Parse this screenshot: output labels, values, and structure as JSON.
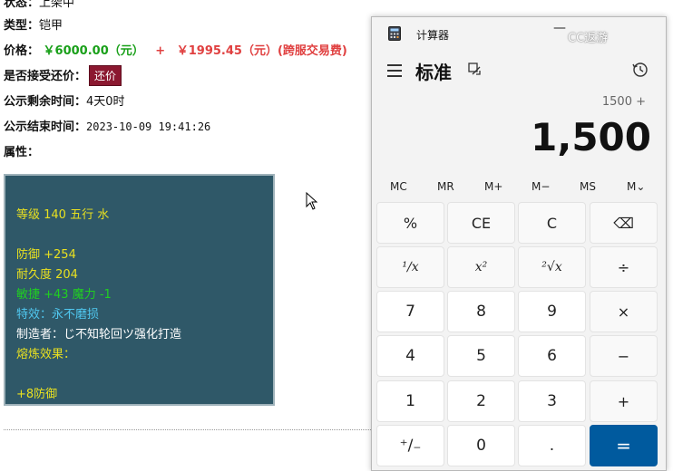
{
  "listing": {
    "status_label": "状态：",
    "status_value": "上架中",
    "type_label": "类型：",
    "type_value": "铠甲",
    "price_label": "价格：",
    "price_main": "￥6000.00（元）",
    "price_plus": "+",
    "price_fee": "￥1995.45（元）(跨服交易费)",
    "counter_label": "是否接受还价：",
    "counter_button": "还价",
    "remain_label": "公示剩余时间：",
    "remain_value": "4天0时",
    "end_label": "公示结束时间：",
    "end_value": "2023-10-09 19:41:26",
    "attr_label": "属性："
  },
  "item": {
    "level_line": "等级 140 五行 水",
    "defense": "防御 +254",
    "durability": "耐久度 204",
    "agility": "敏捷 +43 魔力 -1",
    "special": "特效：永不磨损",
    "maker": "制造者：じ不知轮回ツ强化打造",
    "smelt_label": "熔炼效果：",
    "smelt_value": "+8防御",
    "colors": {
      "yellow": "#e8e020",
      "green": "#20d020",
      "cyan": "#50c8f0",
      "white": "#ffffff"
    }
  },
  "calculator": {
    "title": "计算器",
    "watermark": "CC返游",
    "mode": "标准",
    "expression": "1500 +",
    "display": "1,500",
    "memory": [
      "MC",
      "MR",
      "M+",
      "M−",
      "MS",
      "M⌄"
    ],
    "keys": [
      [
        "%",
        "CE",
        "C",
        "⌫"
      ],
      [
        "¹∕x",
        "x²",
        "²√x",
        "÷"
      ],
      [
        "7",
        "8",
        "9",
        "×"
      ],
      [
        "4",
        "5",
        "6",
        "−"
      ],
      [
        "1",
        "2",
        "3",
        "+"
      ],
      [
        "⁺∕₋",
        "0",
        ".",
        "="
      ]
    ],
    "accent_color": "#005a9e"
  }
}
